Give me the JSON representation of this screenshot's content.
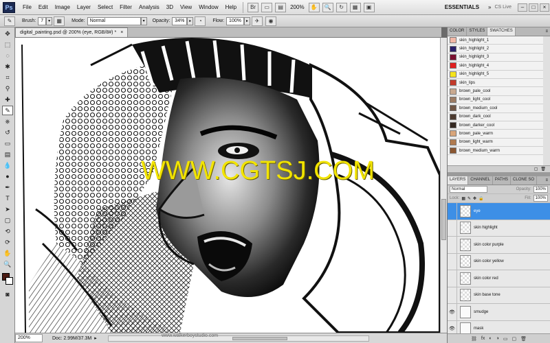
{
  "app": {
    "logo": "Ps",
    "menus": [
      "File",
      "Edit",
      "Image",
      "Layer",
      "Select",
      "Filter",
      "Analysis",
      "3D",
      "View",
      "Window",
      "Help"
    ],
    "zoom": "200%",
    "workspace": "ESSENTIALS",
    "extra": "»",
    "cs_live": "CS Live"
  },
  "options": {
    "brush_label": "Brush:",
    "brush_size": "7",
    "mode_label": "Mode:",
    "mode_value": "Normal",
    "opacity_label": "Opacity:",
    "opacity_value": "34%",
    "flow_label": "Flow:",
    "flow_value": "100%"
  },
  "document": {
    "tab_title": "digital_painting.psd @ 200% (eye, RGB/8#) *",
    "close": "×",
    "status_zoom": "200%",
    "status_doc": "Doc: 2.99M/37.3M",
    "footer_url": "www.walkerboystudio.com"
  },
  "watermark": "WWW.CGTSJ.COM",
  "swatches_panel": {
    "tabs": [
      "COLOR",
      "STYLES",
      "SWATCHES"
    ],
    "active_tab": "SWATCHES",
    "menu": "≡",
    "items": [
      {
        "name": "skin_highlight_1",
        "color": "#f2b7a6"
      },
      {
        "name": "skin_highlight_2",
        "color": "#2a1f6a"
      },
      {
        "name": "skin_highlight_3",
        "color": "#7a1030"
      },
      {
        "name": "skin_highlight_4",
        "color": "#e02020"
      },
      {
        "name": "skin_highlight_5",
        "color": "#f5e31a"
      },
      {
        "name": "skin_lips",
        "color": "#c23a2a"
      },
      {
        "name": "brown_pale_cool",
        "color": "#c9a98f"
      },
      {
        "name": "brown_light_cool",
        "color": "#9c7b63"
      },
      {
        "name": "brown_medium_cool",
        "color": "#705645"
      },
      {
        "name": "brown_dark_cool",
        "color": "#4c3a2f"
      },
      {
        "name": "brown_darker_cool",
        "color": "#342821"
      },
      {
        "name": "brown_pale_warm",
        "color": "#d8a57a"
      },
      {
        "name": "brown_light_warm",
        "color": "#b07a4e"
      },
      {
        "name": "brown_medium_warm",
        "color": "#8a5631"
      }
    ]
  },
  "layers_panel": {
    "tabs": [
      "LAYERS",
      "CHANNEL",
      "PATHS",
      "CLONE SO"
    ],
    "blend_mode": "Normal",
    "opacity_label": "Opacity:",
    "opacity_value": "100%",
    "lock_label": "Lock:",
    "fill_label": "Fill:",
    "fill_value": "100%",
    "layers": [
      {
        "name": "eye",
        "selected": true,
        "visible": false,
        "type": "transparent"
      },
      {
        "name": "skin highlight",
        "selected": false,
        "visible": false,
        "type": "transparent"
      },
      {
        "name": "skin color purple",
        "selected": false,
        "visible": false,
        "type": "transparent"
      },
      {
        "name": "skin color yellow",
        "selected": false,
        "visible": false,
        "type": "transparent"
      },
      {
        "name": "skin color red",
        "selected": false,
        "visible": false,
        "type": "transparent"
      },
      {
        "name": "skin base tone",
        "selected": false,
        "visible": false,
        "type": "transparent"
      },
      {
        "name": "smudge",
        "selected": false,
        "visible": true,
        "type": "sketch"
      },
      {
        "name": "mask",
        "selected": false,
        "visible": true,
        "type": "sketch"
      }
    ],
    "footer_icons": [
      "link-icon",
      "fx-icon",
      "mask-icon",
      "adjustment-icon",
      "group-icon",
      "new-layer-icon",
      "trash-icon"
    ]
  },
  "colors": {
    "foreground": "#4a1a12",
    "background": "#ffffff",
    "selection_blue": "#3d8fe6",
    "watermark": "#f2e400"
  }
}
